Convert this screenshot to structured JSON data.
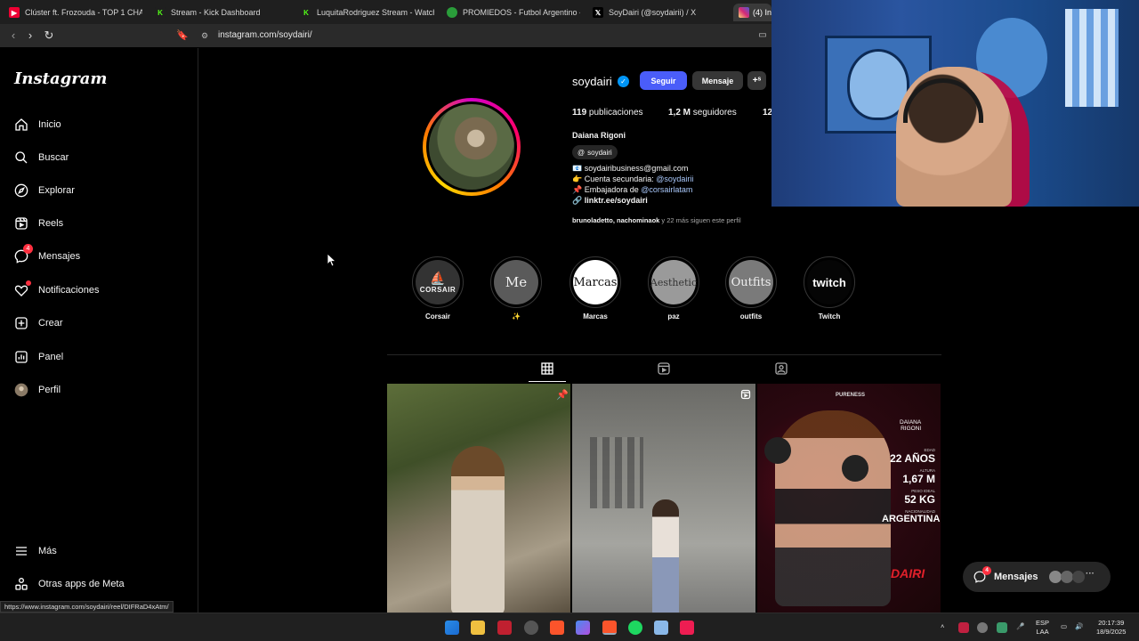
{
  "browser": {
    "tabs": [
      {
        "label": "Clúster ft. Frozouda - TOP 1 CHA"
      },
      {
        "label": "Stream - Kick Dashboard"
      },
      {
        "label": "LuquitaRodriguez Stream - Watch Liv"
      },
      {
        "label": "PROMIEDOS - Futbol Argentino - Fix"
      },
      {
        "label": "SoyDairi (@soydairii) / X"
      },
      {
        "label": "(4) Ins"
      }
    ],
    "url": "instagram.com/soydairi/",
    "status_url": "https://www.instagram.com/soydairi/reel/DIFRaD4xAtm/"
  },
  "sidebar": {
    "logo": "Instagram",
    "items": [
      {
        "label": "Inicio",
        "icon": "home-icon"
      },
      {
        "label": "Buscar",
        "icon": "search-icon"
      },
      {
        "label": "Explorar",
        "icon": "compass-icon"
      },
      {
        "label": "Reels",
        "icon": "reels-icon"
      },
      {
        "label": "Mensajes",
        "icon": "messenger-icon",
        "badge": "4"
      },
      {
        "label": "Notificaciones",
        "icon": "heart-icon"
      },
      {
        "label": "Crear",
        "icon": "plus-square-icon"
      },
      {
        "label": "Panel",
        "icon": "chart-icon"
      },
      {
        "label": "Perfil",
        "icon": "avatar-icon"
      }
    ],
    "bottom": [
      {
        "label": "Más",
        "icon": "menu-icon"
      },
      {
        "label": "Otras apps de Meta",
        "icon": "meta-apps-icon"
      }
    ]
  },
  "profile": {
    "username": "soydairi",
    "follow_label": "Seguir",
    "message_label": "Mensaje",
    "posts_count": "119",
    "posts_label": "publicaciones",
    "followers_count": "1,2 M",
    "followers_label": "seguidores",
    "following_partial": "12",
    "full_name": "Daiana Rigoni",
    "threads_handle": "soydairi",
    "bio": {
      "line1": "📧 soydairibusiness@gmail.com",
      "line2_text": "👉 Cuenta secundaria: ",
      "line2_link": "@soydairii",
      "line3_text": "📌 Embajadora de ",
      "line3_link": "@corsairlatam",
      "line4": "🔗 linktr.ee/soydairi"
    },
    "followed_by_names": "brunoladetto, nachominaok",
    "followed_by_rest": " y 22 más siguen este perfil"
  },
  "highlights": [
    {
      "cover": "CORSAIR",
      "label": "Corsair"
    },
    {
      "cover": "Me",
      "label": "✨"
    },
    {
      "cover": "Marcas",
      "label": "Marcas"
    },
    {
      "cover": "Aesthetic",
      "label": "paz"
    },
    {
      "cover": "Outfits",
      "label": "outfits"
    },
    {
      "cover": "twitch",
      "label": "Twitch"
    }
  ],
  "posts": [
    {
      "alt": "photo"
    },
    {
      "alt": "reel"
    },
    {
      "brand": "PURENESS",
      "name_top": "DAIANA",
      "name_bottom": "RIGONI",
      "stat1_label": "EDAD",
      "stat1_value": "22 AÑOS",
      "stat2_label": "ALTURA",
      "stat2_value": "1,67 M",
      "stat3_label": "PESO IDEAL",
      "stat3_value": "52 KG",
      "stat4_label": "NACIONALIDAD",
      "stat4_value": "ARGENTINA",
      "tag": "DAIRI"
    }
  ],
  "messages_pill": {
    "label": "Mensajes",
    "badge": "4"
  },
  "taskbar": {
    "lang1": "ESP",
    "lang2": "LAA",
    "time": "20:17:39",
    "date": "18/9/2025"
  }
}
